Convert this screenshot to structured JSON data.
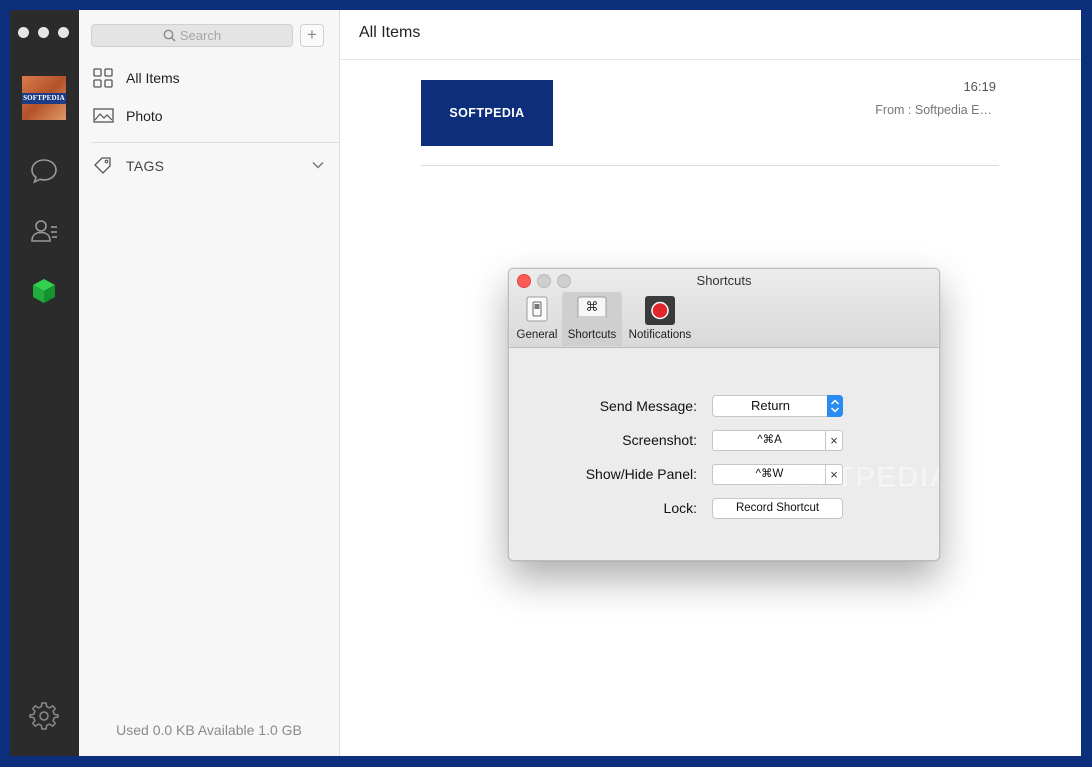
{
  "sidebar": {
    "search_placeholder": "Search",
    "add_label": "+",
    "items": [
      {
        "label": "All Items",
        "icon": "grid-icon"
      },
      {
        "label": "Photo",
        "icon": "image-icon"
      }
    ],
    "tags_label": "TAGS",
    "storage": "Used 0.0 KB Available 1.0 GB"
  },
  "rail": {
    "avatar_text": "SOFTPEDIA",
    "icons": [
      "chat-bubble-icon",
      "contacts-icon",
      "cube-icon",
      "settings-gear-icon"
    ],
    "active_color": "#1bb93a"
  },
  "main": {
    "title": "All Items",
    "item": {
      "thumb_text": "SOFTPEDIA",
      "time": "16:19",
      "from": "From : Softpedia E…"
    }
  },
  "dialog": {
    "title": "Shortcuts",
    "tabs": [
      {
        "label": "General",
        "icon": "general-switch-icon"
      },
      {
        "label": "Shortcuts",
        "icon": "command-key-icon",
        "glyph": "⌘",
        "active": true
      },
      {
        "label": "Notifications",
        "icon": "record-red-icon"
      }
    ],
    "rows": [
      {
        "label": "Send Message:",
        "value": "Return"
      },
      {
        "label": "Screenshot:",
        "value": "^⌘A",
        "clear": "×"
      },
      {
        "label": "Show/Hide Panel:",
        "value": "^⌘W",
        "clear": "×"
      },
      {
        "label": "Lock:",
        "button": "Record Shortcut"
      }
    ],
    "watermark": "SOFTPEDIA"
  }
}
